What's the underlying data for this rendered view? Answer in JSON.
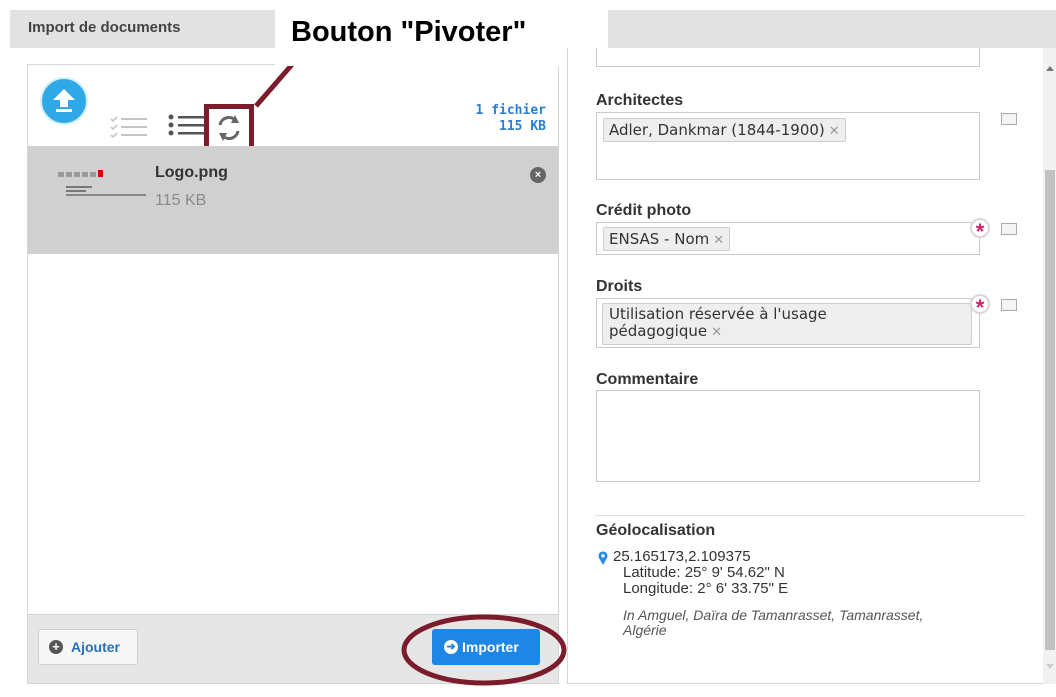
{
  "header": {
    "title": "Import de documents"
  },
  "annotation": {
    "label": "Bouton \"Pivoter\""
  },
  "uploader": {
    "file_count": "1 fichier",
    "total_size": "115 KB",
    "files": [
      {
        "name": "Logo.png",
        "size": "115 KB"
      }
    ],
    "add_label": "Ajouter",
    "import_label": "Importer"
  },
  "form": {
    "architectes": {
      "label": "Architectes",
      "tags": [
        "Adler, Dankmar (1844-1900)"
      ]
    },
    "credit": {
      "label": "Crédit photo",
      "tags": [
        "ENSAS - Nom"
      ]
    },
    "droits": {
      "label": "Droits",
      "tag_line1": "Utilisation réservée à l'usage",
      "tag_line2": "pédagogique"
    },
    "commentaire": {
      "label": "Commentaire",
      "value": ""
    },
    "geo": {
      "label": "Géolocalisation",
      "coords": "25.165173,2.109375",
      "latitude": "Latitude: 25° 9' 54.62\" N",
      "longitude": "Longitude: 2° 6' 33.75\" E",
      "address_line1": "In Amguel, Daïra de Tamanrasset, Tamanrasset,",
      "address_line2": "Algérie"
    }
  },
  "colors": {
    "accent": "#1e86e6",
    "annotation": "#7a1c2b",
    "required": "#d1226a"
  },
  "icons": [
    "upload-icon",
    "list-check-icon",
    "list-icon",
    "rotate-icon",
    "close-icon",
    "plus-icon",
    "arrow-right-icon",
    "book-icon",
    "required-icon",
    "map-pin-icon",
    "scroll-up-icon",
    "scroll-down-icon"
  ]
}
